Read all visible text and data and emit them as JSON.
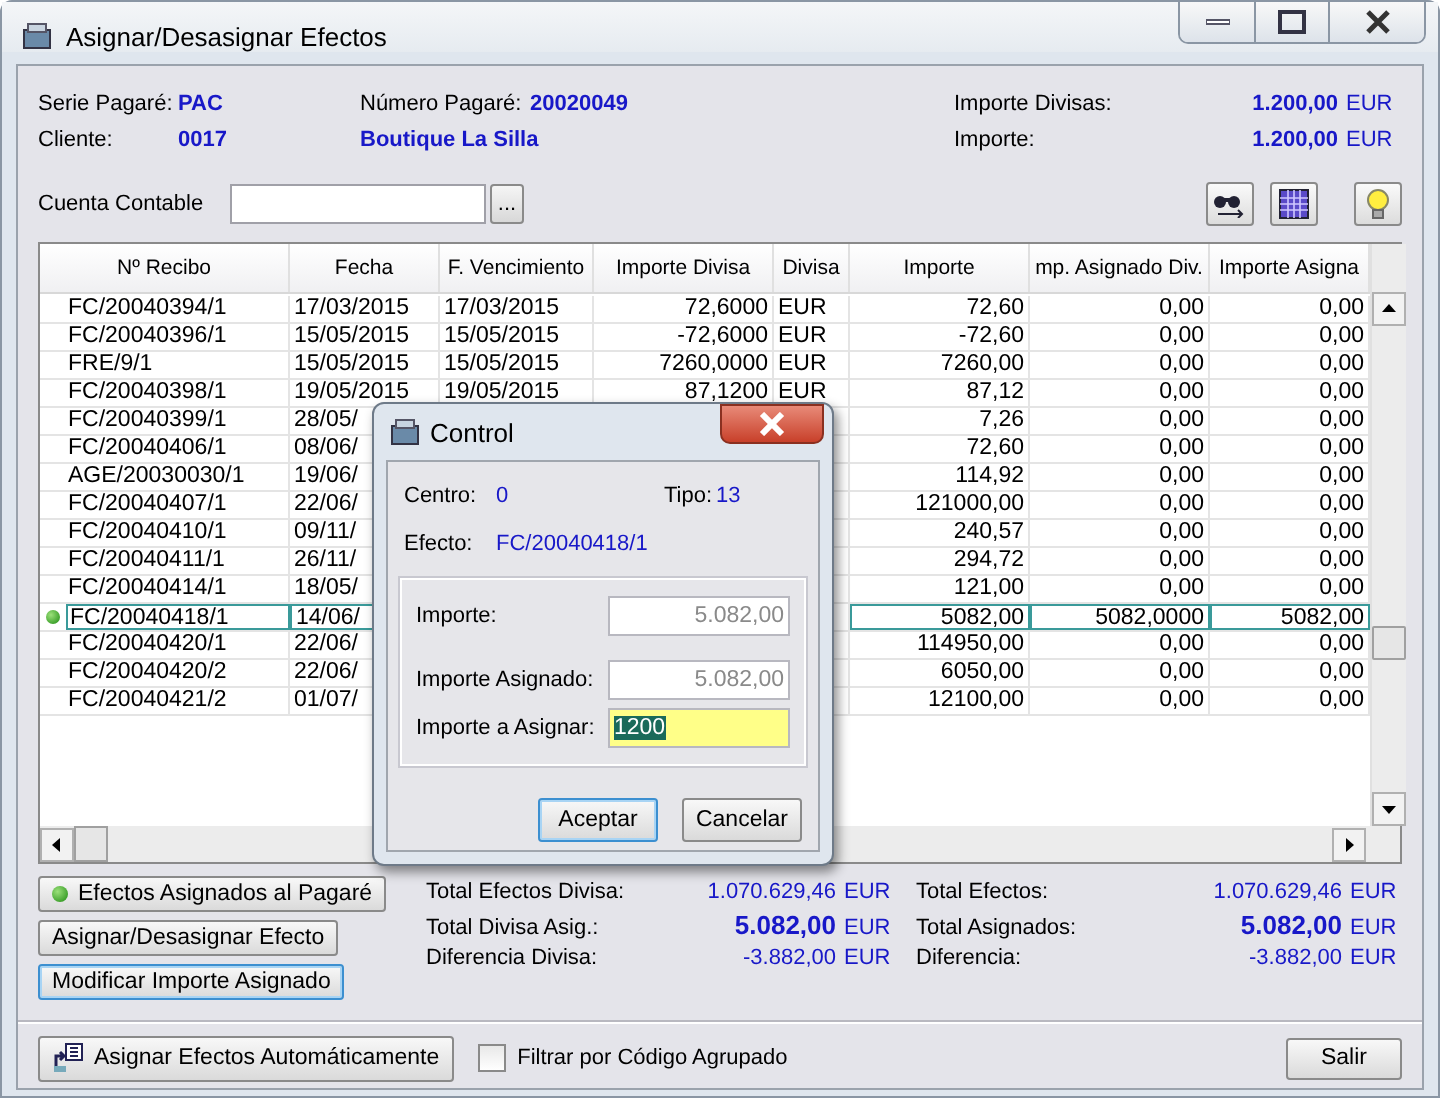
{
  "window": {
    "title": "Asignar/Desasignar Efectos"
  },
  "header": {
    "serie_label": "Serie Pagaré:",
    "serie": "PAC",
    "numero_label": "Número Pagaré:",
    "numero": "20020049",
    "importe_divisas_label": "Importe Divisas:",
    "importe_divisas": "1.200,00",
    "importe_divisas_currency": "EUR",
    "cliente_label": "Cliente:",
    "cliente": "0017",
    "cliente_name": "Boutique La Silla",
    "importe_label": "Importe:",
    "importe": "1.200,00",
    "importe_currency": "EUR",
    "cuenta_label": "Cuenta Contable",
    "cuenta_button": "..."
  },
  "table": {
    "columns": [
      "Nº Recibo",
      "Fecha",
      "F. Vencimiento",
      "Importe Divisa",
      "Divisa",
      "Importe",
      "mp. Asignado Div.",
      "Importe Asigna"
    ],
    "rows": [
      {
        "selected": false,
        "recibo": "FC/20040394/1",
        "fecha": "17/03/2015",
        "vencimiento": "17/03/2015",
        "importe_divisa": "72,6000",
        "divisa": "EUR",
        "importe": "72,60",
        "asignado_div": "0,00",
        "importe_asignado": "0,00"
      },
      {
        "selected": false,
        "recibo": "FC/20040396/1",
        "fecha": "15/05/2015",
        "vencimiento": "15/05/2015",
        "importe_divisa": "-72,6000",
        "divisa": "EUR",
        "importe": "-72,60",
        "asignado_div": "0,00",
        "importe_asignado": "0,00"
      },
      {
        "selected": false,
        "recibo": "FRE/9/1",
        "fecha": "15/05/2015",
        "vencimiento": "15/05/2015",
        "importe_divisa": "7260,0000",
        "divisa": "EUR",
        "importe": "7260,00",
        "asignado_div": "0,00",
        "importe_asignado": "0,00"
      },
      {
        "selected": false,
        "recibo": "FC/20040398/1",
        "fecha": "19/05/2015",
        "vencimiento": "19/05/2015",
        "importe_divisa": "87,1200",
        "divisa": "EUR",
        "importe": "87,12",
        "asignado_div": "0,00",
        "importe_asignado": "0,00"
      },
      {
        "selected": false,
        "recibo": "FC/20040399/1",
        "fecha": "28/05/",
        "importe": "7,26",
        "asignado_div": "0,00",
        "importe_asignado": "0,00"
      },
      {
        "selected": false,
        "recibo": "FC/20040406/1",
        "fecha": "08/06/",
        "importe": "72,60",
        "asignado_div": "0,00",
        "importe_asignado": "0,00"
      },
      {
        "selected": false,
        "recibo": "AGE/20030030/1",
        "fecha": "19/06/",
        "importe": "114,92",
        "asignado_div": "0,00",
        "importe_asignado": "0,00"
      },
      {
        "selected": false,
        "recibo": "FC/20040407/1",
        "fecha": "22/06/",
        "importe": "121000,00",
        "asignado_div": "0,00",
        "importe_asignado": "0,00"
      },
      {
        "selected": false,
        "recibo": "FC/20040410/1",
        "fecha": "09/11/",
        "importe": "240,57",
        "asignado_div": "0,00",
        "importe_asignado": "0,00"
      },
      {
        "selected": false,
        "recibo": "FC/20040411/1",
        "fecha": "26/11/",
        "importe": "294,72",
        "asignado_div": "0,00",
        "importe_asignado": "0,00"
      },
      {
        "selected": false,
        "recibo": "FC/20040414/1",
        "fecha": "18/05/",
        "importe": "121,00",
        "asignado_div": "0,00",
        "importe_asignado": "0,00"
      },
      {
        "selected": true,
        "recibo": "FC/20040418/1",
        "fecha": "14/06/",
        "importe": "5082,00",
        "asignado_div": "5082,0000",
        "importe_asignado": "5082,00"
      },
      {
        "selected": false,
        "recibo": "FC/20040420/1",
        "fecha": "22/06/",
        "importe": "114950,00",
        "asignado_div": "0,00",
        "importe_asignado": "0,00"
      },
      {
        "selected": false,
        "recibo": "FC/20040420/2",
        "fecha": "22/06/",
        "importe": "6050,00",
        "asignado_div": "0,00",
        "importe_asignado": "0,00"
      },
      {
        "selected": false,
        "recibo": "FC/20040421/2",
        "fecha": "01/07/",
        "importe": "12100,00",
        "asignado_div": "0,00",
        "importe_asignado": "0,00"
      }
    ]
  },
  "buttons": [
    {
      "label": "Efectos Asignados al Pagaré",
      "kind": "legend",
      "focused": false
    },
    {
      "label": "Asignar/Desasignar Efecto",
      "kind": "plain",
      "focused": false
    },
    {
      "label": "Modificar Importe Asignado",
      "kind": "plain",
      "focused": true
    }
  ],
  "totals_left": [
    {
      "label": "Total Efectos Divisa:",
      "value": "1.070.629,46",
      "currency": "EUR",
      "bold": false
    },
    {
      "label": "Total Divisa Asig.:",
      "value": "5.082,00",
      "currency": "EUR",
      "bold": true
    },
    {
      "label": "Diferencia Divisa:",
      "value": "-3.882,00",
      "currency": "EUR",
      "bold": false
    }
  ],
  "totals_right": [
    {
      "label": "Total Efectos:",
      "value": "1.070.629,46",
      "currency": "EUR",
      "bold": false
    },
    {
      "label": "Total Asignados:",
      "value": "5.082,00",
      "currency": "EUR",
      "bold": true
    },
    {
      "label": "Diferencia:",
      "value": "-3.882,00",
      "currency": "EUR",
      "bold": false
    }
  ],
  "footer": {
    "auto_button": "Asignar Efectos Automáticamente",
    "filter_label": "Filtrar por Código Agrupado",
    "filter_checked": false,
    "exit_button": "Salir"
  },
  "dialog": {
    "title": "Control",
    "centro_label": "Centro:",
    "centro": "0",
    "tipo_label": "Tipo:",
    "tipo": "13",
    "efecto_label": "Efecto:",
    "efecto": "FC/20040418/1",
    "fields": [
      {
        "label": "Importe:",
        "value": "5.082,00",
        "disabled": true,
        "highlighted": false
      },
      {
        "label": "Importe Asignado:",
        "value": "5.082,00",
        "disabled": true,
        "highlighted": false
      },
      {
        "label": "Importe a Asignar:",
        "value": "1200",
        "disabled": false,
        "highlighted": true
      }
    ],
    "buttons": [
      {
        "label": "Aceptar",
        "focused": true
      },
      {
        "label": "Cancelar",
        "focused": false
      }
    ]
  }
}
